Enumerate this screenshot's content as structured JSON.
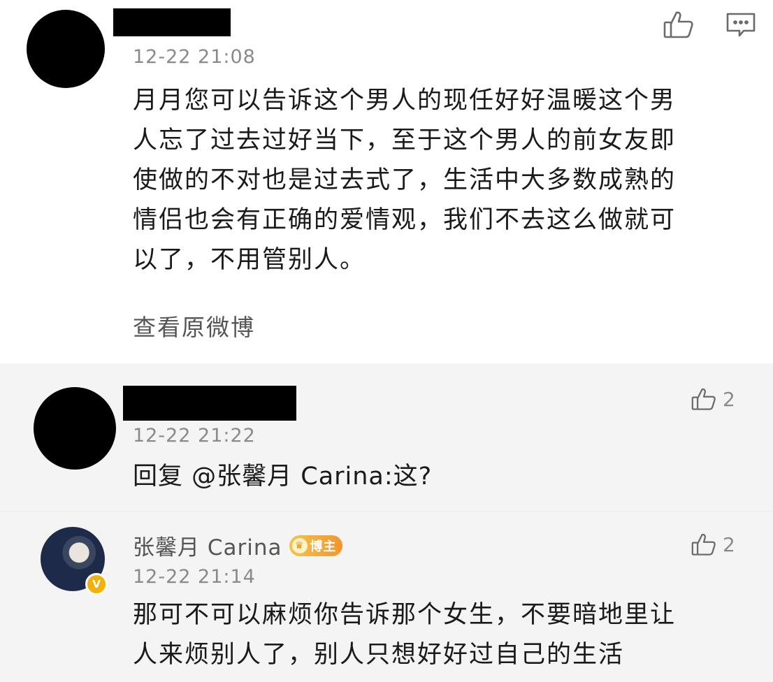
{
  "comments": [
    {
      "time": "12-22 21:08",
      "content_lines": [
        "月月您可以告诉这个男人的现任好好温暖这个男",
        "人忘了过去过好当下，至于这个男人的前女友即",
        "使做的不对也是过去式了，生活中大多数成熟的",
        "情侣也会有正确的爱情观，我们不去这么做就可",
        "以了，不用管别人。"
      ],
      "view_original": "查看原微博"
    },
    {
      "time": "12-22 21:22",
      "content": "回复 @张馨月 Carina:这?",
      "likes": "2"
    },
    {
      "username": "张馨月 Carina",
      "badge": "博主",
      "time": "12-22 21:14",
      "content_lines": [
        "那可不可以麻烦你告诉那个女生，不要暗地里让",
        "人来烦别人了，别人只想好好过自己的生活"
      ],
      "likes": "2"
    }
  ],
  "colors": {
    "badge": "#f0962e",
    "verified": "#f3b20a",
    "meta_text": "#8a8a8a"
  }
}
